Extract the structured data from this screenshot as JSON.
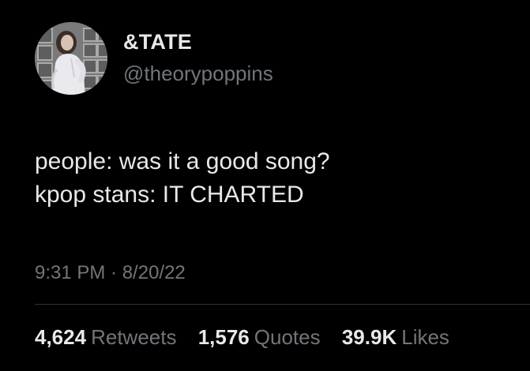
{
  "colors": {
    "background": "#000000",
    "primary_text": "#e7e9ea",
    "secondary_text": "#71767b",
    "divider": "#2f3336"
  },
  "author": {
    "display_name": "&TATE",
    "handle": "@theorypoppins",
    "avatar_icon": "profile-photo"
  },
  "tweet": {
    "lines": [
      "people: was it a good song?",
      "kpop stans: IT CHARTED"
    ],
    "timestamp": "9:31 PM · 8/20/22"
  },
  "stats": {
    "retweets": {
      "count": "4,624",
      "label": "Retweets"
    },
    "quotes": {
      "count": "1,576",
      "label": "Quotes"
    },
    "likes": {
      "count": "39.9K",
      "label": "Likes"
    }
  }
}
